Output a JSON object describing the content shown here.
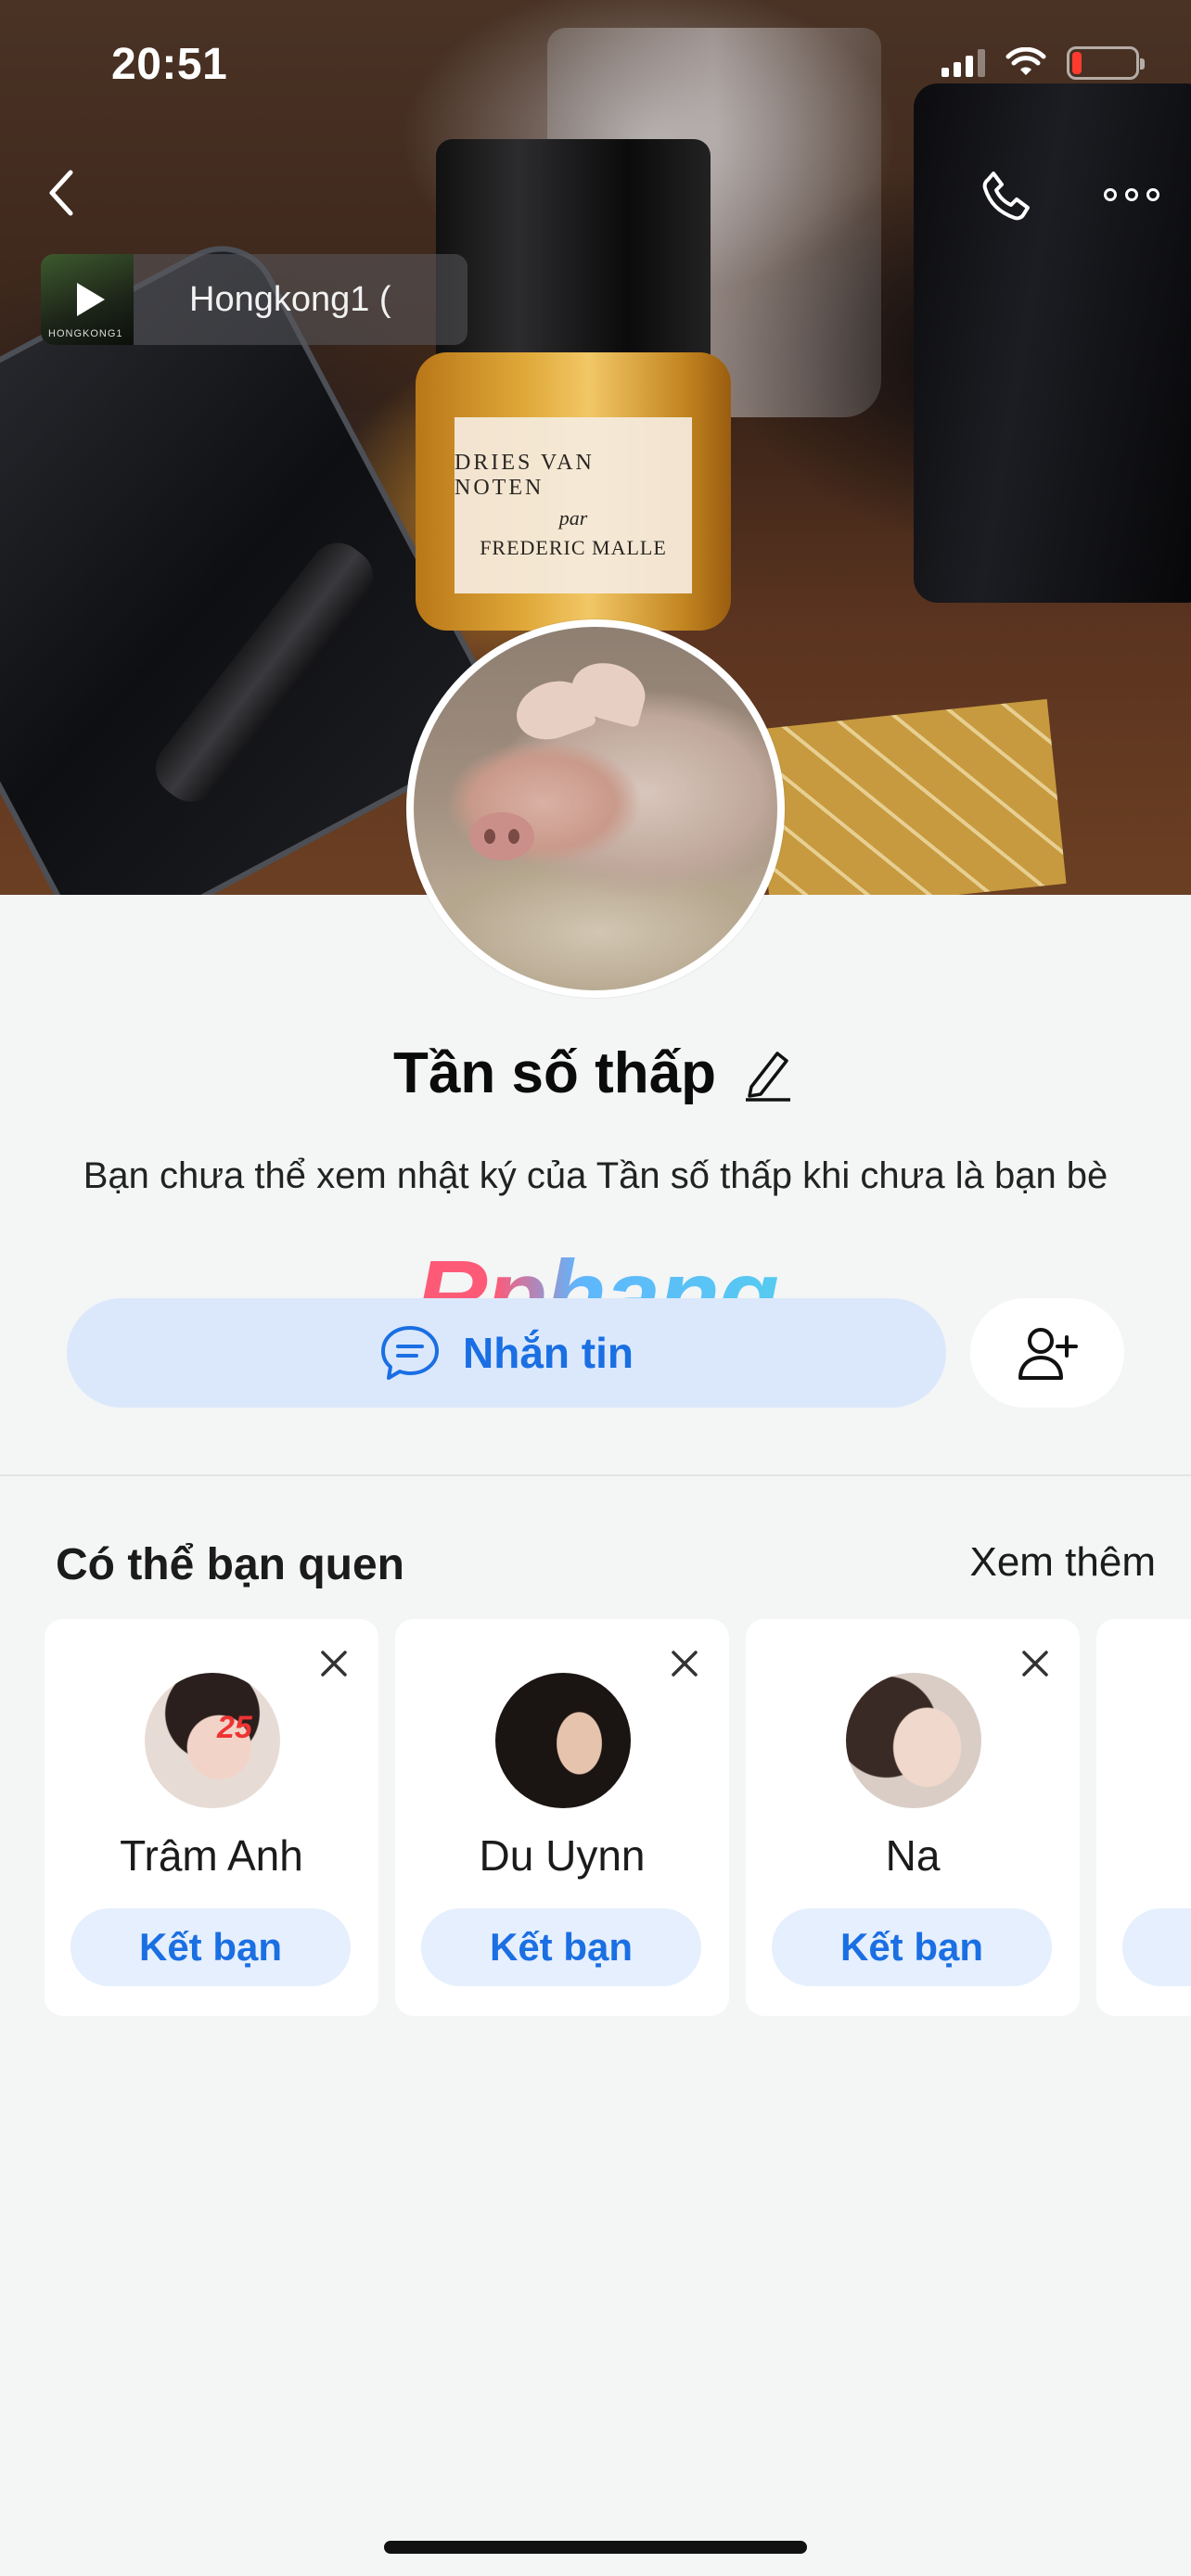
{
  "status_bar": {
    "time": "20:51",
    "battery_level": 0.15
  },
  "nav": {
    "back_icon": "chevron-left-icon",
    "call_icon": "phone-icon",
    "more_icon": "ellipsis-icon"
  },
  "music": {
    "title": "Hongkong1 (",
    "thumb_caption": "HONGKONG1"
  },
  "cover": {
    "label_line1": "DRIES VAN NOTEN",
    "label_line2": "par",
    "label_line3": "FREDERIC MALLE"
  },
  "profile": {
    "name": "Tần số thấp",
    "notice": "Bạn chưa thể xem nhật ký của Tần số thấp khi chưa là bạn bè"
  },
  "watermark": "Rphang",
  "actions": {
    "message_label": "Nhắn tin",
    "add_friend_icon": "user-plus-icon"
  },
  "suggestions": {
    "title": "Có thể bạn quen",
    "see_more": "Xem thêm",
    "items": [
      {
        "name": "Trâm Anh",
        "button": "Kết bạn",
        "badge": "25"
      },
      {
        "name": "Du Uynn",
        "button": "Kết bạn"
      },
      {
        "name": "Na",
        "button": "Kết bạn"
      }
    ]
  },
  "colors": {
    "accent": "#1a6fe3",
    "accent_bg": "#dbe8fc",
    "page_bg": "#f4f5f5"
  }
}
